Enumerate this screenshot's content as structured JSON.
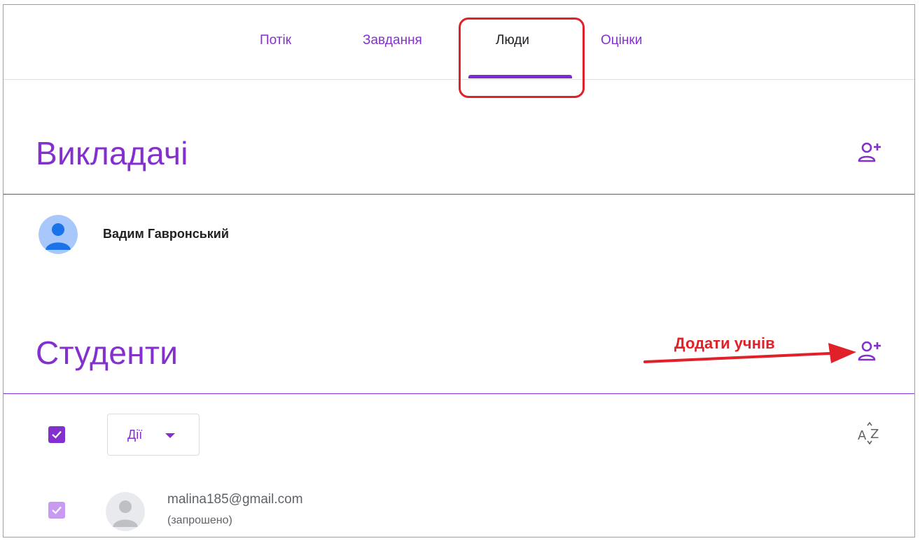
{
  "tabs": [
    {
      "label": "Потік"
    },
    {
      "label": "Завдання"
    },
    {
      "label": "Люди"
    },
    {
      "label": "Оцінки"
    }
  ],
  "active_tab": "Люди",
  "teachers": {
    "title": "Викладачі",
    "add_icon": "person-add-icon",
    "items": [
      {
        "name": "Вадим Гавронський"
      }
    ]
  },
  "students": {
    "title": "Студенти",
    "add_icon": "person-add-icon",
    "actions_label": "Дії",
    "sort_icon": "sort-az-icon",
    "items": [
      {
        "email": "malina185@gmail.com",
        "status": "(запрошено)"
      }
    ]
  },
  "annotation": {
    "text": "Додати учнів",
    "color": "#e0212a"
  },
  "colors": {
    "accent": "#8430ce",
    "highlight": "#e0212a"
  }
}
